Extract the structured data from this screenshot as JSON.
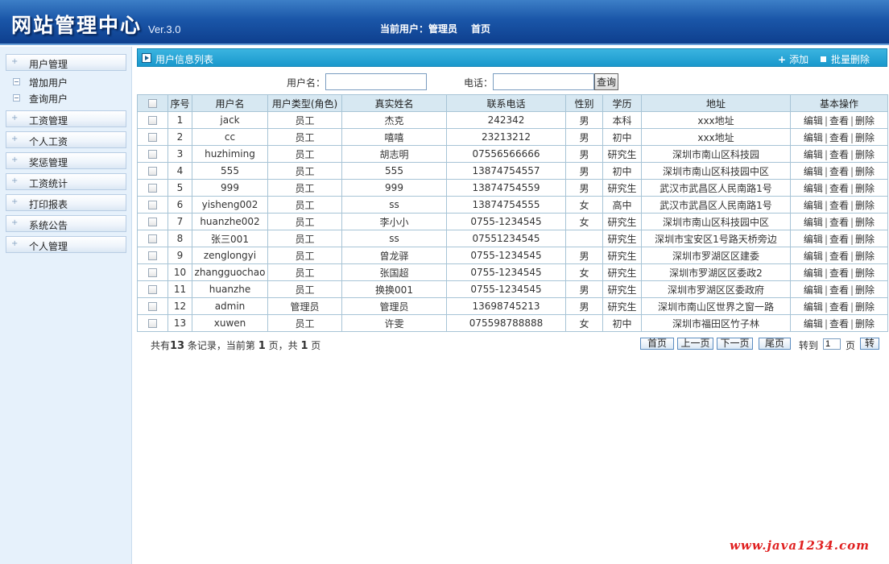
{
  "header": {
    "logo": "网站管理中心",
    "version": "Ver.3.0",
    "current_user": "当前用户：管理员",
    "home": "首页"
  },
  "sidebar": {
    "groups": [
      {
        "label": "用户管理",
        "sub": [
          "增加用户",
          "查询用户"
        ]
      },
      {
        "label": "工资管理"
      },
      {
        "label": "个人工资"
      },
      {
        "label": "奖惩管理"
      },
      {
        "label": "工资统计"
      },
      {
        "label": "打印报表"
      },
      {
        "label": "系统公告"
      },
      {
        "label": "个人管理"
      }
    ]
  },
  "main": {
    "title": "用户信息列表",
    "add": "添加",
    "batch_delete": "批量删除",
    "search": {
      "username_label": "用户名：",
      "username_value": "",
      "phone_label": "电话：",
      "phone_value": "",
      "button": "查询"
    },
    "table": {
      "headers": [
        "",
        "序号",
        "用户名",
        "用户类型(角色)",
        "真实姓名",
        "联系电话",
        "性别",
        "学历",
        "地址",
        "基本操作"
      ],
      "rows": [
        [
          "1",
          "jack",
          "员工",
          "杰克",
          "242342",
          "男",
          "本科",
          "xxx地址"
        ],
        [
          "2",
          "cc",
          "员工",
          "嘻嘻",
          "23213212",
          "男",
          "初中",
          "xxx地址"
        ],
        [
          "3",
          "huzhiming",
          "员工",
          "胡志明",
          "07556566666",
          "男",
          "研究生",
          "深圳市南山区科技园"
        ],
        [
          "4",
          "555",
          "员工",
          "555",
          "13874754557",
          "男",
          "初中",
          "深圳市南山区科技园中区"
        ],
        [
          "5",
          "999",
          "员工",
          "999",
          "13874754559",
          "男",
          "研究生",
          "武汉市武昌区人民南路1号"
        ],
        [
          "6",
          "yisheng002",
          "员工",
          "ss",
          "13874754555",
          "女",
          "高中",
          "武汉市武昌区人民南路1号"
        ],
        [
          "7",
          "huanzhe002",
          "员工",
          "李小小",
          "0755-1234545",
          "女",
          "研究生",
          "深圳市南山区科技园中区"
        ],
        [
          "8",
          "张三001",
          "员工",
          "ss",
          "07551234545",
          "",
          "研究生",
          "深圳市宝安区1号路天桥旁边"
        ],
        [
          "9",
          "zenglongyi",
          "员工",
          "曾龙驿",
          "0755-1234545",
          "男",
          "研究生",
          "深圳市罗湖区区建委"
        ],
        [
          "10",
          "zhangguochao",
          "员工",
          "张国超",
          "0755-1234545",
          "女",
          "研究生",
          "深圳市罗湖区区委政2"
        ],
        [
          "11",
          "huanzhe",
          "员工",
          "换换001",
          "0755-1234545",
          "男",
          "研究生",
          "深圳市罗湖区区委政府"
        ],
        [
          "12",
          "admin",
          "管理员",
          "管理员",
          "13698745213",
          "男",
          "研究生",
          "深圳市南山区世界之窗一路"
        ],
        [
          "13",
          "xuwen",
          "员工",
          "许雯",
          "075598788888",
          "女",
          "初中",
          "深圳市福田区竹子林"
        ]
      ],
      "ops": [
        "编辑",
        "查看",
        "删除"
      ]
    },
    "pager": {
      "prefix": "共有",
      "total": "13",
      "mid1": " 条记录，当前第 ",
      "current": "1",
      "mid2": " 页，共 ",
      "pages": "1",
      "suffix": " 页",
      "first": "首页",
      "prev": "上一页",
      "next": "下一页",
      "last": "尾页",
      "goto_label": "转到",
      "goto_value": "1",
      "page_unit": "页",
      "go": "转"
    }
  },
  "watermark": "www.java1234.com"
}
